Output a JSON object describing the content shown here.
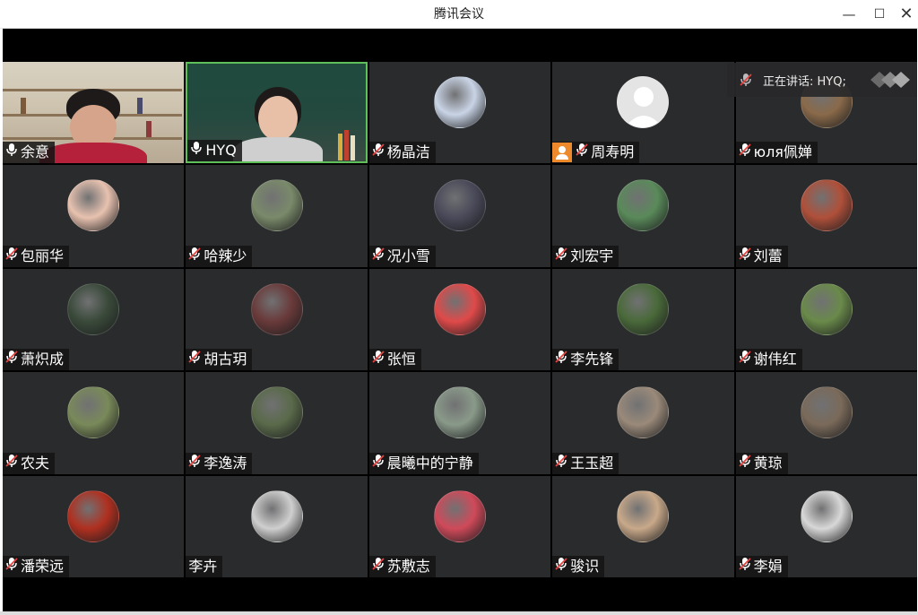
{
  "window": {
    "title": "腾讯会议"
  },
  "window_controls": {
    "minimize": "—",
    "maximize": "☐",
    "close": "✕"
  },
  "speaking": {
    "text": "正在讲话: HYQ;"
  },
  "colors": {
    "tile_bg": "#2a2b2d",
    "active_border": "#5fbf58",
    "mute_red": "#e64340",
    "host_orange": "#ee8a2b"
  },
  "participants": [
    {
      "name": "余意",
      "mic": "on",
      "type": "video-a"
    },
    {
      "name": "HYQ",
      "mic": "on",
      "type": "video-b"
    },
    {
      "name": "杨晶洁",
      "mic": "muted",
      "type": "avatar",
      "color": "#c9d4e6"
    },
    {
      "name": "周寿明",
      "mic": "muted",
      "type": "avatar",
      "color": "#dcdcdc",
      "host": true
    },
    {
      "name": "юля佩婵",
      "mic": "muted",
      "type": "avatar",
      "color": "#8a6a4a"
    },
    {
      "name": "包丽华",
      "mic": "muted",
      "type": "avatar",
      "color": "#e8c2b0"
    },
    {
      "name": "哈辣少",
      "mic": "muted",
      "type": "avatar",
      "color": "#7a8a6a"
    },
    {
      "name": "况小雪",
      "mic": "muted",
      "type": "avatar",
      "color": "#4a4a5a"
    },
    {
      "name": "刘宏宇",
      "mic": "muted",
      "type": "avatar",
      "color": "#5a8a5a"
    },
    {
      "name": "刘蕾",
      "mic": "muted",
      "type": "avatar",
      "color": "#b0503a"
    },
    {
      "name": "萧炽成",
      "mic": "muted",
      "type": "avatar",
      "color": "#3a4a3a"
    },
    {
      "name": "胡古玥",
      "mic": "muted",
      "type": "avatar",
      "color": "#6a3a3a"
    },
    {
      "name": "张恒",
      "mic": "muted",
      "type": "avatar",
      "color": "#e04a4a"
    },
    {
      "name": "李先锋",
      "mic": "muted",
      "type": "avatar",
      "color": "#4a6a3a"
    },
    {
      "name": "谢伟红",
      "mic": "muted",
      "type": "avatar",
      "color": "#6a8a4a"
    },
    {
      "name": "农夫",
      "mic": "muted",
      "type": "avatar",
      "color": "#7a8a5a"
    },
    {
      "name": "李逸涛",
      "mic": "muted",
      "type": "avatar",
      "color": "#5a6a4a"
    },
    {
      "name": "晨曦中的宁静",
      "mic": "muted",
      "type": "avatar",
      "color": "#8a9a8a"
    },
    {
      "name": "王玉超",
      "mic": "muted",
      "type": "avatar",
      "color": "#9a8a7a"
    },
    {
      "name": "黄琼",
      "mic": "muted",
      "type": "avatar",
      "color": "#7a6a5a"
    },
    {
      "name": "潘荣远",
      "mic": "muted",
      "type": "avatar",
      "color": "#b03020"
    },
    {
      "name": "李卉",
      "mic": "none",
      "type": "avatar",
      "color": "#cfcfcf"
    },
    {
      "name": "苏敷志",
      "mic": "muted",
      "type": "avatar",
      "color": "#d04a5a"
    },
    {
      "name": "骏识",
      "mic": "muted",
      "type": "avatar",
      "color": "#c9a98a"
    },
    {
      "name": "李娟",
      "mic": "muted",
      "type": "avatar",
      "color": "#d8d8d8"
    }
  ]
}
